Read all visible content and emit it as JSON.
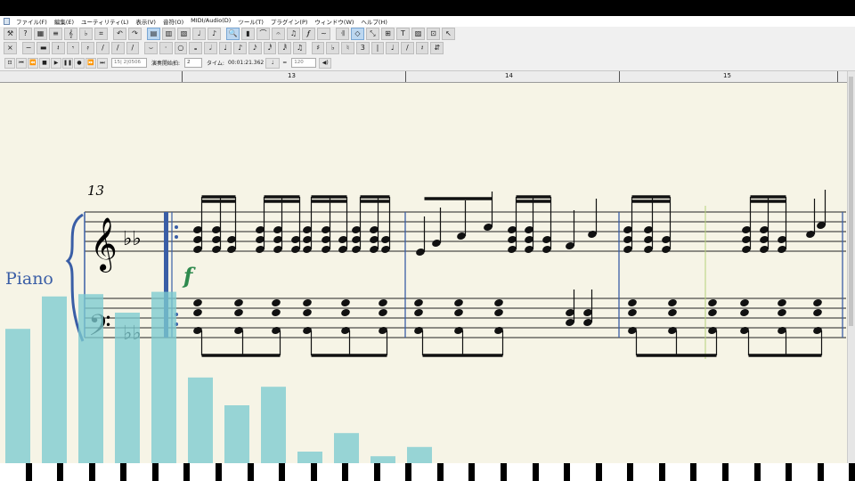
{
  "menu": [
    "ファイル(F)",
    "編集(E)",
    "ユーティリティ(L)",
    "表示(V)",
    "音符(O)",
    "MIDI/Audio(D)",
    "ツール(T)",
    "プラグイン(P)",
    "ウィンドウ(W)",
    "ヘルプ(H)"
  ],
  "toolbar1": [
    {
      "name": "wrench-tool-icon",
      "g": "⚒"
    },
    {
      "name": "paint-tool-icon",
      "g": "?"
    },
    {
      "name": "layout-tool-icon",
      "g": "▦"
    },
    {
      "name": "staff-tool-icon",
      "g": "≡"
    },
    {
      "name": "clef-tool-icon",
      "g": "𝄞"
    },
    {
      "name": "key-tool-icon",
      "g": "♭"
    },
    {
      "name": "time-tool-icon",
      "g": "⌗"
    },
    {
      "name": "undo-icon",
      "g": "↶"
    },
    {
      "name": "redo-icon",
      "g": "↷"
    },
    {
      "name": "select-tool-icon",
      "g": "▤",
      "active": true
    },
    {
      "name": "measure-tool-icon",
      "g": "▥"
    },
    {
      "name": "page-tool-icon",
      "g": "▧"
    },
    {
      "name": "note-tool-icon",
      "g": "♩"
    },
    {
      "name": "speedy-tool-icon",
      "g": "♪"
    },
    {
      "name": "zoom-tool-icon",
      "g": "🔍",
      "active": true
    },
    {
      "name": "hand-tool-icon",
      "g": "▮"
    },
    {
      "name": "smart-shape-tool-icon",
      "g": "⌒"
    },
    {
      "name": "lyrics-tool-icon",
      "g": "𝄐"
    },
    {
      "name": "chord-tool-icon",
      "g": "♫"
    },
    {
      "name": "expression-tool-icon",
      "g": "𝆑"
    },
    {
      "name": "articulation-tool-icon",
      "g": "~"
    },
    {
      "name": "repeat-tool-icon",
      "g": "𝄇"
    },
    {
      "name": "mirror-tool-icon",
      "g": "◇",
      "active": true
    },
    {
      "name": "resize-tool-icon",
      "g": "⤡"
    },
    {
      "name": "special-tool-icon",
      "g": "⊞"
    },
    {
      "name": "text-tool-icon",
      "g": "T"
    },
    {
      "name": "graphics-tool-icon",
      "g": "▨"
    },
    {
      "name": "staff-style-tool-icon",
      "g": "⊡"
    },
    {
      "name": "pointer-tool-icon",
      "g": "↖"
    }
  ],
  "toolbar2": [
    {
      "name": "close-palette-icon",
      "g": "×"
    },
    {
      "name": "whole-rest-icon",
      "g": "−"
    },
    {
      "name": "half-rest-icon",
      "g": "▬"
    },
    {
      "name": "quarter-rest-icon",
      "g": "𝄽"
    },
    {
      "name": "eighth-rest-icon",
      "g": "𝄾"
    },
    {
      "name": "sixteenth-rest-icon",
      "g": "𝄿"
    },
    {
      "name": "thirtysecond-rest-icon",
      "g": "/"
    },
    {
      "name": "sixtyfourth-rest-icon",
      "g": "/"
    },
    {
      "name": "grace-icon",
      "g": "/"
    },
    {
      "name": "tie-icon",
      "g": "⌣"
    },
    {
      "name": "dot-icon",
      "g": "·"
    },
    {
      "name": "double-whole-note-icon",
      "g": "○"
    },
    {
      "name": "whole-note-icon",
      "g": "𝅝"
    },
    {
      "name": "half-note-icon",
      "g": "𝅗𝅥"
    },
    {
      "name": "quarter-note-icon",
      "g": "♩"
    },
    {
      "name": "eighth-note-icon",
      "g": "♪"
    },
    {
      "name": "sixteenth-note-icon",
      "g": "𝅘𝅥𝅯"
    },
    {
      "name": "thirtysecond-note-icon",
      "g": "𝅘𝅥𝅰"
    },
    {
      "name": "sixtyfourth-note-icon",
      "g": "𝅘𝅥𝅱"
    },
    {
      "name": "beam-icon",
      "g": "♫"
    },
    {
      "name": "sharp-icon",
      "g": "♯"
    },
    {
      "name": "flat-icon",
      "g": "♭"
    },
    {
      "name": "natural-icon",
      "g": "♮"
    },
    {
      "name": "tuplet-icon",
      "g": "3"
    },
    {
      "name": "stem-icon",
      "g": "|"
    },
    {
      "name": "cue-icon",
      "g": "♩"
    },
    {
      "name": "slash-icon",
      "g": "/"
    },
    {
      "name": "rest-toggle-icon",
      "g": "𝄽"
    },
    {
      "name": "cross-staff-icon",
      "g": "⇵"
    }
  ],
  "transport": {
    "buttons": [
      {
        "name": "loop-icon",
        "g": "⊡"
      },
      {
        "name": "rewind-start-icon",
        "g": "⏮"
      },
      {
        "name": "rewind-icon",
        "g": "⏪"
      },
      {
        "name": "stop-icon",
        "g": "■"
      },
      {
        "name": "play-icon",
        "g": "▶"
      },
      {
        "name": "pause-icon",
        "g": "❚❚"
      },
      {
        "name": "record-icon",
        "g": "●"
      },
      {
        "name": "fast-forward-icon",
        "g": "⏩"
      },
      {
        "name": "forward-end-icon",
        "g": "⏭"
      }
    ],
    "counter": "15| 2|0506",
    "start_label": "演奏開始拍:",
    "start_value": "2",
    "time_label": "タイム:",
    "time_value": "00:01:21.362",
    "tempo_eq": "=",
    "tempo_value": "120"
  },
  "ruler": [
    "13",
    "14",
    "15"
  ],
  "score": {
    "measure_number": "13",
    "instrument": "Piano",
    "dynamic": "f"
  },
  "colors": {
    "page": "#f6f4e6",
    "visualizer": "#7ccbd0",
    "barline": "#3a5ea6",
    "dynamic": "#2f8a4e"
  },
  "visualizer_levels": [
    0.58,
    0.72,
    0.73,
    0.65,
    0.74,
    0.37,
    0.25,
    0.33,
    0.05,
    0.13,
    0.03,
    0.07,
    0.0
  ]
}
